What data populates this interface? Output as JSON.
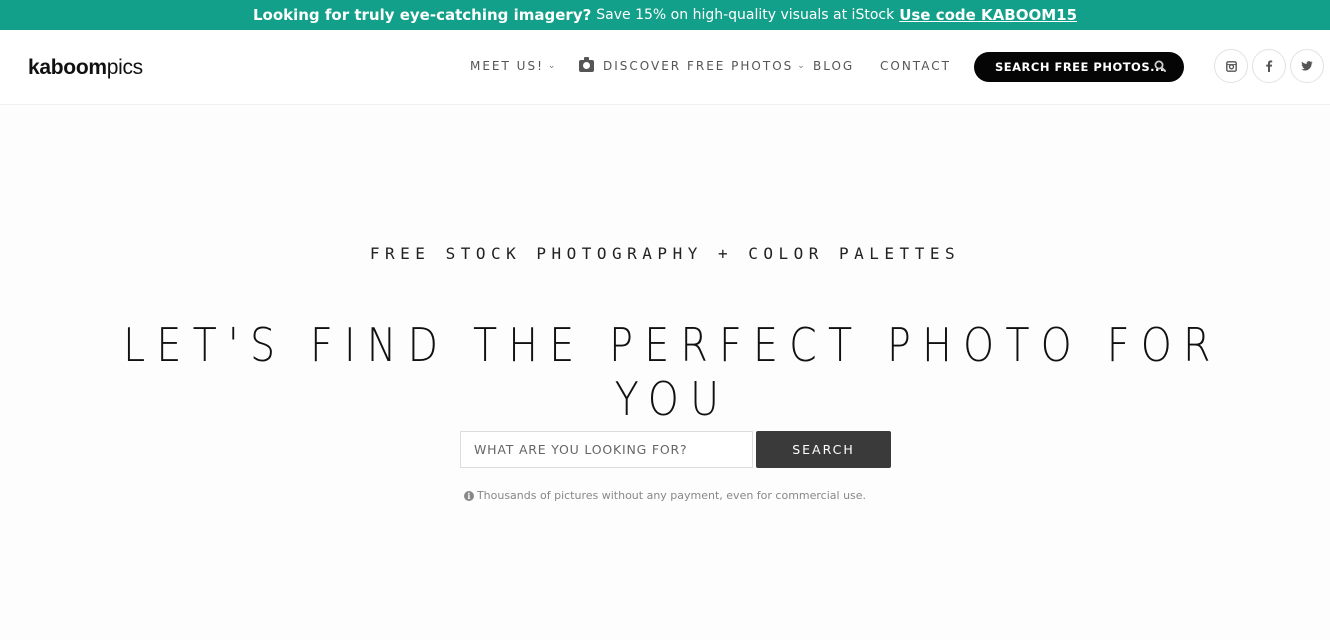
{
  "promo": {
    "bold_text": "Looking for truly eye-catching imagery?",
    "text": "Save 15% on high-quality visuals at iStock",
    "code_link": "Use code KABOOM15",
    "color": "#12a08a"
  },
  "logo": {
    "bold": "kaboom",
    "light": "pics"
  },
  "nav": {
    "meet_us": "MEET US!",
    "discover": "DISCOVER FREE PHOTOS",
    "blog": "BLOG",
    "contact": "CONTACT",
    "discover_icon": "camera-icon",
    "dropdown_icon": "chevron-down-icon"
  },
  "header_search": {
    "label": "SEARCH FREE PHOTOS...",
    "icon": "search-icon"
  },
  "social": [
    {
      "name": "instagram-icon"
    },
    {
      "name": "facebook-icon"
    },
    {
      "name": "twitter-icon"
    }
  ],
  "hero": {
    "tagline": "FREE STOCK PHOTOGRAPHY + COLOR PALETTES",
    "headline": "LET'S FIND THE PERFECT PHOTO FOR YOU"
  },
  "search": {
    "placeholder": "WHAT ARE YOU LOOKING FOR?",
    "button": "SEARCH"
  },
  "note": {
    "text": "Thousands of pictures without any payment, even for commercial use.",
    "icon": "info-icon"
  }
}
